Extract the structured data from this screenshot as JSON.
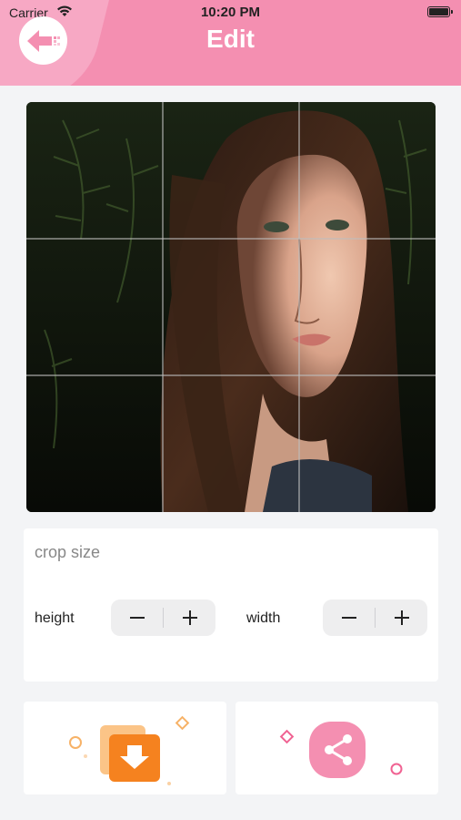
{
  "status_bar": {
    "carrier": "Carrier",
    "time": "10:20 PM"
  },
  "header": {
    "title": "Edit",
    "back_icon": "back-arrow-icon"
  },
  "photo": {
    "grid": "3x3 crop grid"
  },
  "crop_panel": {
    "title": "crop size",
    "height_label": "height",
    "width_label": "width",
    "minus_symbol": "−",
    "plus_symbol": "+"
  },
  "actions": {
    "save_icon": "download-folder-icon",
    "share_icon": "share-icon"
  },
  "colors": {
    "header": "#f48fb1",
    "accent_orange": "#f5821f",
    "accent_pink": "#f06292"
  }
}
